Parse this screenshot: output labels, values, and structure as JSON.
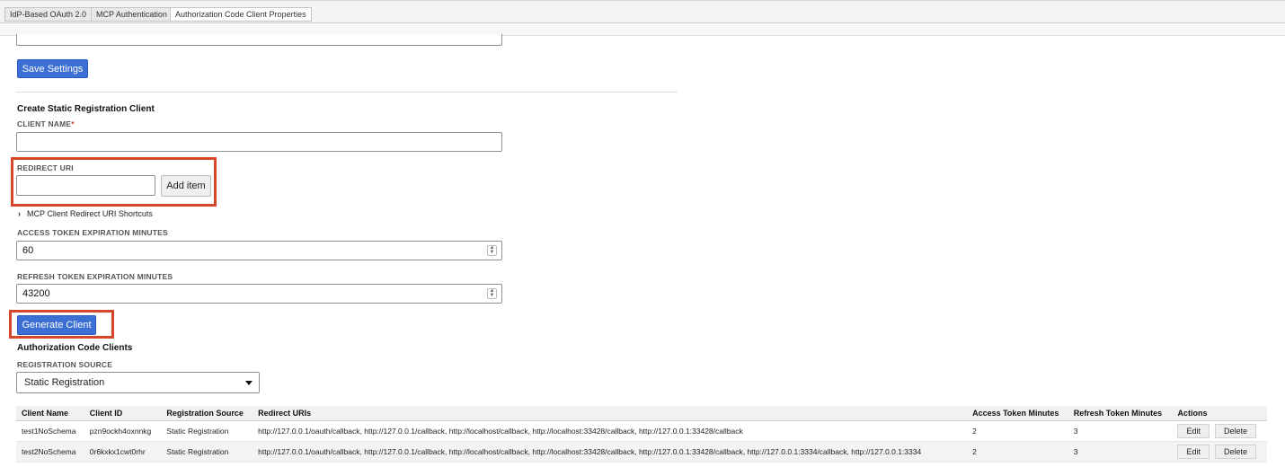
{
  "tabs": [
    {
      "label": "IdP-Based OAuth 2.0",
      "active": false
    },
    {
      "label": "MCP Authentication",
      "active": false
    },
    {
      "label": "Authorization Code Client Properties",
      "active": true
    }
  ],
  "settings": {
    "save_label": "Save Settings"
  },
  "create": {
    "heading": "Create Static Registration Client",
    "client_name_label": "CLIENT NAME",
    "required_mark": "*",
    "client_name_value": "",
    "redirect_label": "REDIRECT URI",
    "redirect_value": "",
    "add_item_label": "Add item",
    "shortcuts_chevron": "›",
    "shortcuts_label": "MCP Client Redirect URI Shortcuts",
    "access_label": "ACCESS TOKEN EXPIRATION MINUTES",
    "access_value": "60",
    "refresh_label": "REFRESH TOKEN EXPIRATION MINUTES",
    "refresh_value": "43200",
    "generate_label": "Generate Client"
  },
  "clients": {
    "heading": "Authorization Code Clients",
    "source_label": "REGISTRATION SOURCE",
    "source_value": "Static Registration",
    "columns": [
      "Client Name",
      "Client ID",
      "Registration Source",
      "Redirect URIs",
      "Access Token Minutes",
      "Refresh Token Minutes",
      "Actions"
    ],
    "rows": [
      {
        "name": "test1NoSchema",
        "id": "pzn9ockh4oxnnkg",
        "source": "Static Registration",
        "uris": "http://127.0.0.1/oauth/callback, http://127.0.0.1/callback, http://localhost/callback, http://localhost:33428/callback, http://127.0.0.1:33428/callback",
        "access": "2",
        "refresh": "3",
        "edit": "Edit",
        "delete": "Delete"
      },
      {
        "name": "test2NoSchema",
        "id": "0r6kxkx1cwt0rhr",
        "source": "Static Registration",
        "uris": "http://127.0.0.1/oauth/callback, http://127.0.0.1/callback, http://localhost/callback, http://localhost:33428/callback, http://127.0.0.1:33428/callback, http://127.0.0.1:3334/callback, http://127.0.0.1:3334",
        "access": "2",
        "refresh": "3",
        "edit": "Edit",
        "delete": "Delete"
      }
    ]
  },
  "icons": {
    "spinner_up": "▲",
    "spinner_down": "▼"
  }
}
